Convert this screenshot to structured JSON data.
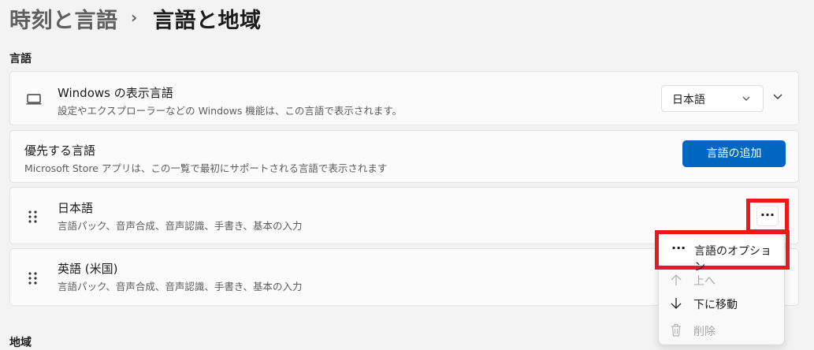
{
  "breadcrumb": {
    "parent": "時刻と言語",
    "separator": "›",
    "current": "言語と地域"
  },
  "sections": {
    "language": "言語",
    "region": "地域"
  },
  "display_language": {
    "title": "Windows の表示言語",
    "description": "設定やエクスプローラーなどの Windows 機能は、この言語で表示されます。",
    "selected": "日本語",
    "icon": "monitor-icon"
  },
  "preferred_languages": {
    "title": "優先する言語",
    "description": "Microsoft Store アプリは、この一覧で最初にサポートされる言語で表示されます",
    "add_button": "言語の追加"
  },
  "languages": [
    {
      "name": "日本語",
      "features": "言語パック、音声合成、音声認識、手書き、基本の入力"
    },
    {
      "name": "英語 (米国)",
      "features": "言語パック、音声合成、音声認識、手書き、基本の入力"
    }
  ],
  "more_button": "···",
  "context_menu": {
    "options": {
      "icon": "···",
      "label": "言語のオプション"
    },
    "move_up": {
      "label": "上へ",
      "disabled": true
    },
    "move_down": {
      "label": "下に移動",
      "disabled": false
    },
    "remove": {
      "label": "削除",
      "disabled": true
    }
  },
  "colors": {
    "accent": "#0067c0",
    "highlight": "#e81a1a",
    "background": "#f3f3f3"
  }
}
